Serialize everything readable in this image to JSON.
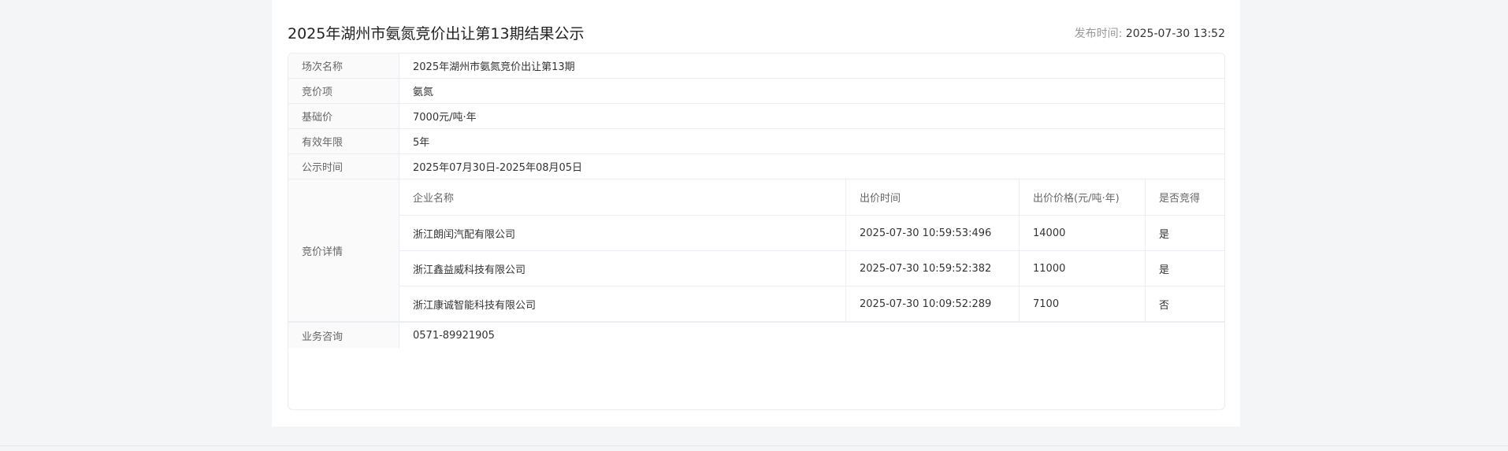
{
  "header": {
    "title": "2025年湖州市氨氮竞价出让第13期结果公示",
    "publish_label": "发布时间: ",
    "publish_time": "2025-07-30 13:52"
  },
  "info_rows": [
    {
      "label": "场次名称",
      "value": "2025年湖州市氨氮竞价出让第13期"
    },
    {
      "label": "竞价项",
      "value": "氨氮"
    },
    {
      "label": "基础价",
      "value": "7000元/吨·年"
    },
    {
      "label": "有效年限",
      "value": "5年"
    },
    {
      "label": "公示时间",
      "value": "2025年07月30日-2025年08月05日"
    }
  ],
  "bid_details": {
    "label": "竞价详情",
    "columns": [
      "企业名称",
      "出价时间",
      "出价价格(元/吨·年)",
      "是否竞得"
    ],
    "rows": [
      [
        "浙江朗闰汽配有限公司",
        "2025-07-30 10:59:53:496",
        "14000",
        "是"
      ],
      [
        "浙江鑫益威科技有限公司",
        "2025-07-30 10:59:52:382",
        "11000",
        "是"
      ],
      [
        "浙江康诚智能科技有限公司",
        "2025-07-30 10:09:52:289",
        "7100",
        "否"
      ]
    ]
  },
  "consult": {
    "label": "业务咨询",
    "value": "0571-89921905"
  }
}
